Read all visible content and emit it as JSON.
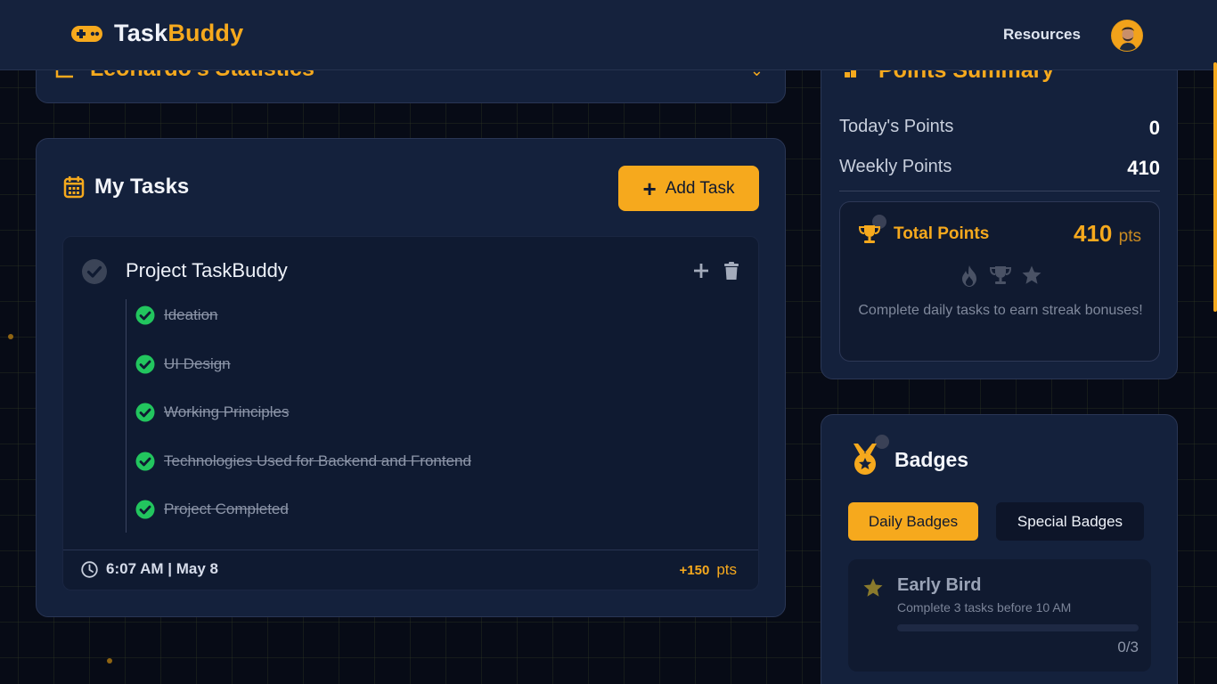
{
  "app": {
    "name_part1": "Task",
    "name_part2": "Buddy",
    "nav_resources": "Resources",
    "accent_color": "#f6a91d"
  },
  "stats": {
    "title": "Leonardo's Statistics"
  },
  "tasks": {
    "heading": "My Tasks",
    "add_label": "Add Task",
    "project": {
      "title": "Project TaskBuddy",
      "subtasks": [
        {
          "label": "Ideation",
          "done": true
        },
        {
          "label": "UI Design",
          "done": true
        },
        {
          "label": "Working Principles",
          "done": true
        },
        {
          "label": "Technologies Used for Backend and Frontend",
          "done": true
        },
        {
          "label": "Project Completed",
          "done": true
        }
      ],
      "time": "6:07 AM | May 8",
      "points": "+150",
      "points_unit": "pts"
    }
  },
  "points": {
    "title": "Points Summary",
    "today_label": "Today's Points",
    "today_value": "0",
    "weekly_label": "Weekly Points",
    "weekly_value": "410",
    "total_label": "Total Points",
    "total_value": "410",
    "total_unit": "pts",
    "streak_icons": [
      "flame-icon",
      "trophy-icon",
      "star-icon"
    ],
    "streak_note": "Complete daily tasks to earn streak bonuses!"
  },
  "badges": {
    "title": "Badges",
    "tab_daily": "Daily Badges",
    "tab_special": "Special Badges",
    "items": [
      {
        "name": "Early Bird",
        "desc": "Complete 3 tasks before 10 AM",
        "progress": "0/3",
        "progress_fraction": 0
      }
    ]
  }
}
